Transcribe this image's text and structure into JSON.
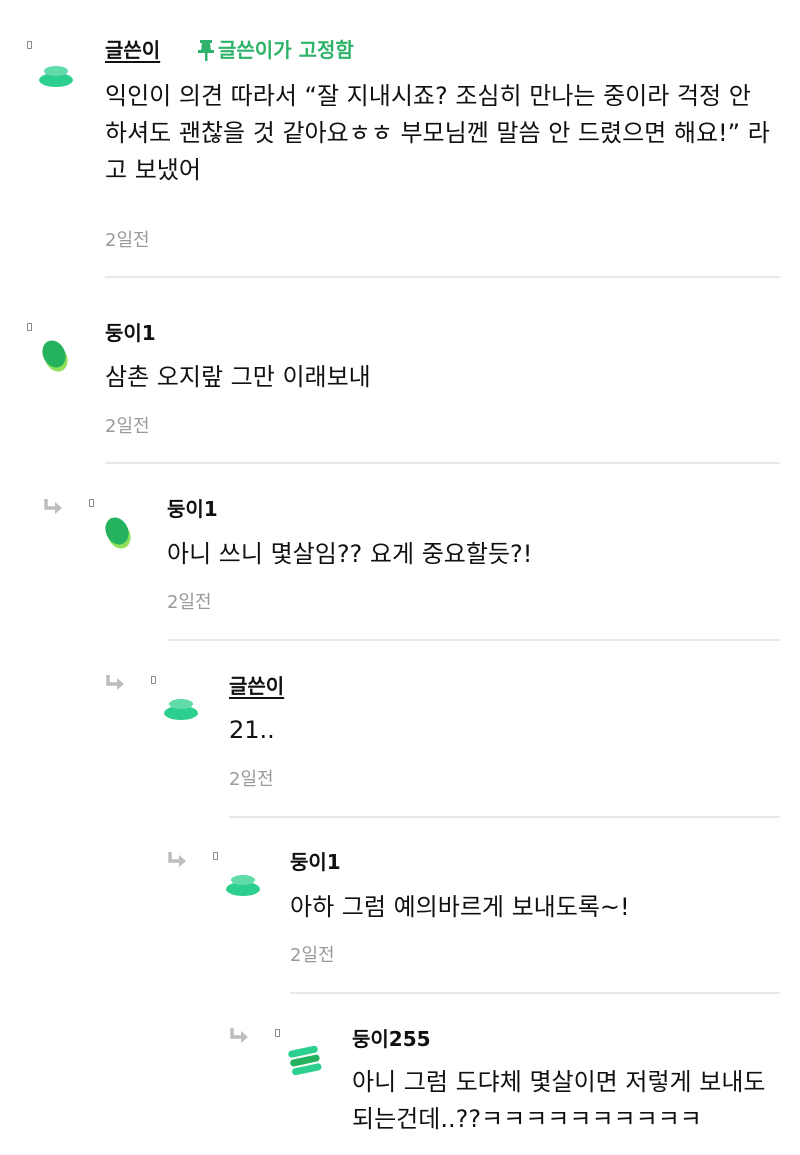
{
  "colors": {
    "pin_green": "#2fb36a",
    "avatar_teal": "#2dcf8e",
    "avatar_green": "#25b25f",
    "avatar_lime": "#8fe05a",
    "divider": "#e8e8e8",
    "timestamp": "#9a9a9a"
  },
  "pin_label": "글쓴이가 고정함",
  "comments": [
    {
      "author": "글쓴이",
      "text": "익인이 의견 따라서 “잘 지내시죠? 조심히 만나는 중이라 걱정 안 하셔도 괜찮을 것 같아요ㅎㅎ 부모님껜 말씀 안 드렸으면 해요!” 라고 보냈어",
      "time": "2일전",
      "avatar_icon": "stacked-disc-icon"
    },
    {
      "author": "둥이1",
      "text": "삼촌 오지랖 그만 이래보내",
      "time": "2일전",
      "avatar_icon": "leaf-blob-icon"
    },
    {
      "author": "둥이1",
      "text": "아니 쓰니 몇살임?? 요게 중요할듯?!",
      "time": "2일전",
      "avatar_icon": "leaf-blob-icon"
    },
    {
      "author": "글쓴이",
      "text": "21..",
      "time": "2일전",
      "avatar_icon": "stacked-disc-icon"
    },
    {
      "author": "둥이1",
      "text": "아하 그럼 예의바르게 보내도록~!",
      "time": "2일전",
      "avatar_icon": "stacked-disc-icon"
    },
    {
      "author": "둥이255",
      "text": "아니 그럼 도댜체 몇살이면 저렇게 보내도 되는건데..??ㅋㅋㅋㅋㅋㅋㅋㅋㅋㅋ",
      "avatar_icon": "stacked-stripes-icon"
    }
  ]
}
